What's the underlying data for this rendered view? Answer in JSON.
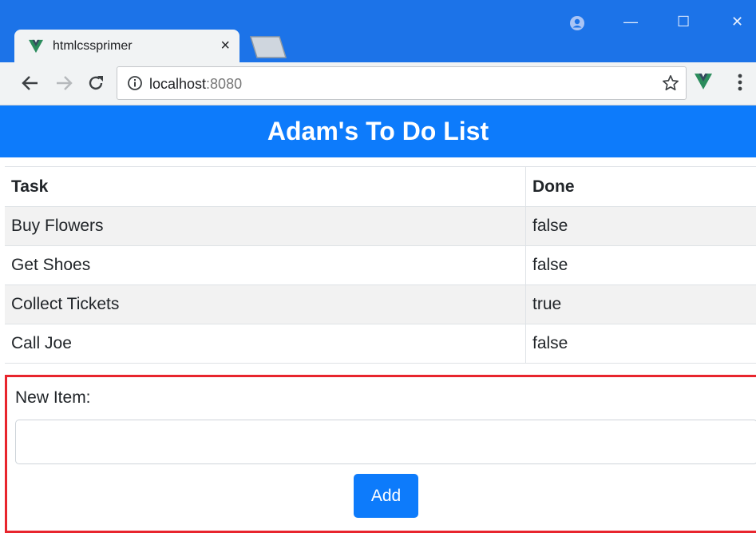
{
  "browser": {
    "tab_title": "htmlcssprimer",
    "tab_close": "×",
    "url_host": "localhost",
    "url_port": ":8080",
    "window_controls": {
      "minimize": "—",
      "maximize": "☐",
      "close": "✕"
    },
    "icons": [
      "vue-favicon-icon",
      "profile-icon",
      "back-arrow-icon",
      "forward-arrow-icon",
      "reload-icon",
      "info-icon",
      "star-icon",
      "vue-extension-icon",
      "menu-dots-icon"
    ]
  },
  "page": {
    "title": "Adam's To Do List",
    "table": {
      "headers": [
        "Task",
        "Done"
      ],
      "rows": [
        [
          "Buy Flowers",
          "false"
        ],
        [
          "Get Shoes",
          "false"
        ],
        [
          "Collect Tickets",
          "true"
        ],
        [
          "Call Joe",
          "false"
        ]
      ]
    },
    "form": {
      "label": "New Item:",
      "input_value": "",
      "button_label": "Add"
    }
  },
  "colors": {
    "titlebar": "#1c73e8",
    "banner": "#0d7bfb",
    "highlight_border": "#e8252d",
    "vue_green": "#2b8c5c"
  }
}
